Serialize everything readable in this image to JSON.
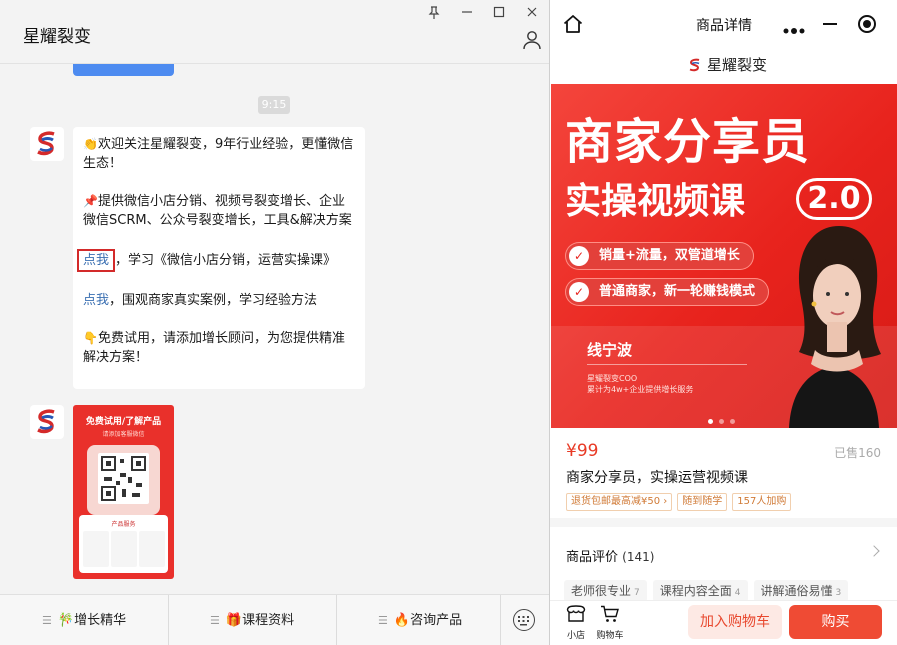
{
  "chat": {
    "title": "星耀裂变",
    "time": "9:15",
    "message": {
      "line1": "欢迎关注星耀裂变，9年行业经验，更懂微信生态！",
      "line2": "提供微信小店分销、视频号裂变增长、企业微信SCRM、公众号裂变增长，工具&解决方案",
      "link1": "点我",
      "line3": "，学习《微信小店分销，运营实操课》",
      "link2": "点我",
      "line4": "，围观商家真实案例，学习经验方法",
      "line5": "免费试用，请添加增长顾问，为您提供精准解决方案！"
    },
    "poster": {
      "title": "免费试用/了解产品",
      "subtitle": "请添加客服微信",
      "panel_title": "产品服务"
    },
    "menu": [
      {
        "label": "增长精华",
        "icon": "🎋"
      },
      {
        "label": "课程资料",
        "icon": "🎁"
      },
      {
        "label": "咨询产品",
        "icon": "🔥"
      }
    ]
  },
  "mini_program": {
    "nav_title": "商品详情",
    "brand": "星耀裂变",
    "hero": {
      "title_line1": "商家分享员",
      "title_line2": "实操视频课",
      "version": "2.0",
      "point1": "销量+流量，双管道增长",
      "point2": "普通商家，新一轮赚钱模式",
      "speaker": "线宁波",
      "role1": "星耀裂变COO",
      "role2": "累计为4w+企业提供增长服务"
    },
    "price": "¥99",
    "sold": "已售160",
    "product_name": "商家分享员，实操运营视频课",
    "tags": [
      "退货包邮最高减¥50 ›",
      "随到随学",
      "157人加购"
    ],
    "reviews": {
      "title": "商品评价",
      "count": "(141)",
      "tags": [
        {
          "text": "老师很专业",
          "count": "7"
        },
        {
          "text": "课程内容全面",
          "count": "4"
        },
        {
          "text": "讲解通俗易懂",
          "count": "3"
        }
      ]
    },
    "bottom": {
      "shop": "小店",
      "cart": "购物车",
      "add_cart": "加入购物车",
      "buy": "购买"
    }
  },
  "colors": {
    "accent_red": "#e8231d",
    "price_red": "#e83a25",
    "link_blue": "#3a6fb2"
  }
}
